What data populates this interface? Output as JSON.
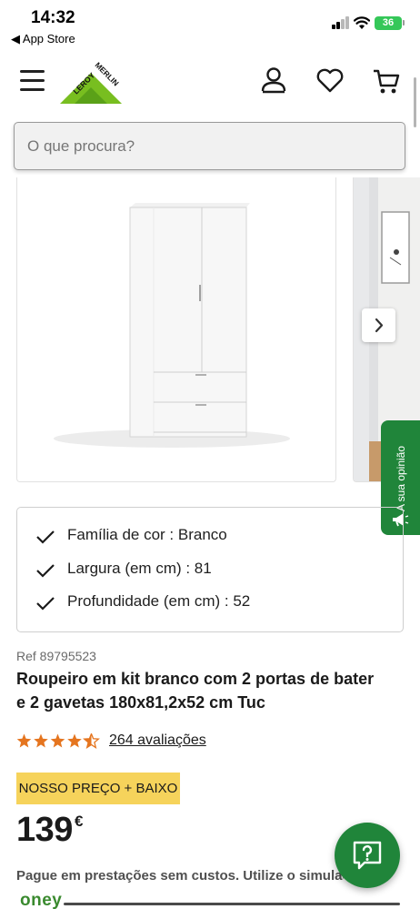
{
  "status_bar": {
    "time": "14:32",
    "back_label": "◀ App Store",
    "battery": "36"
  },
  "header": {
    "logo_text": "LEROY MERLIN",
    "icons": [
      "menu-icon",
      "account-icon",
      "heart-icon",
      "cart-icon"
    ]
  },
  "search": {
    "placeholder": "O que procura?"
  },
  "gallery": {
    "feedback_label": "A sua opinião"
  },
  "attributes": [
    {
      "text": "Família de cor : Branco"
    },
    {
      "text": "Largura (em cm) : 81"
    },
    {
      "text": "Profundidade (em cm) : 52"
    }
  ],
  "product": {
    "ref": "Ref 89795523",
    "title_line1": "Roupeiro em kit branco com 2 portas de bater",
    "title_line2": "e 2 gavetas 180x81,2x52 cm Tuc",
    "rating": 4.5,
    "reviews": "264 avaliações",
    "badge": "NOSSO PREÇO + BAIXO",
    "price": "139",
    "currency": "€",
    "installments": "Pague em prestações sem custos. Utilize o simulador",
    "financing_brand": "oney"
  },
  "colors": {
    "brand_green": "#20853a",
    "logo_green": "#78be20",
    "star_orange": "#e5751f",
    "badge_yellow": "#f6d35b"
  }
}
